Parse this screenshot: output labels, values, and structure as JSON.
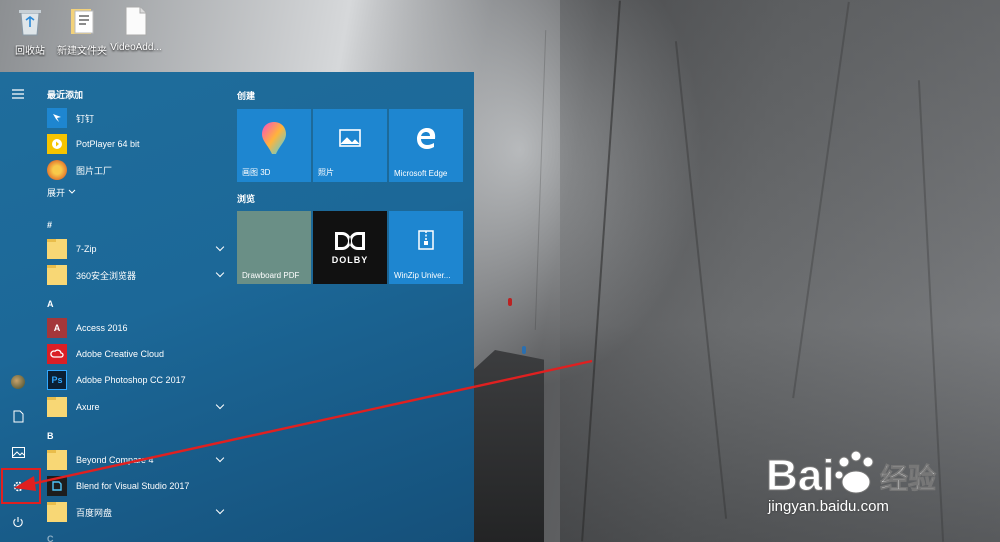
{
  "desktop": {
    "icons": [
      {
        "label": "回收站",
        "icon": "recycle-bin-icon"
      },
      {
        "label": "新建文件夹",
        "icon": "folder-icon"
      },
      {
        "label": "VideoAdd...",
        "icon": "file-icon"
      }
    ]
  },
  "start_menu": {
    "recent_header": "最近添加",
    "recent_apps": [
      {
        "name": "钉钉",
        "icon": "dingtalk-icon"
      },
      {
        "name": "PotPlayer 64 bit",
        "icon": "potplayer-icon"
      },
      {
        "name": "图片工厂",
        "icon": "picture-factory-icon"
      }
    ],
    "expand_label": "展开",
    "letters": {
      "hash": "#",
      "a": "A",
      "b": "B",
      "c": "C"
    },
    "apps_hash": [
      {
        "name": "7-Zip"
      },
      {
        "name": "360安全浏览器"
      }
    ],
    "apps_a": [
      {
        "name": "Access 2016",
        "icon_text": "A"
      },
      {
        "name": "Adobe Creative Cloud"
      },
      {
        "name": "Adobe Photoshop CC 2017",
        "icon_text": "Ps"
      },
      {
        "name": "Axure"
      }
    ],
    "apps_b": [
      {
        "name": "Beyond Compare 4"
      },
      {
        "name": "Blend for Visual Studio 2017"
      },
      {
        "name": "百度网盘"
      }
    ],
    "groups": [
      {
        "title": "创建",
        "tiles": [
          {
            "label": "画图 3D",
            "icon": "paint3d-icon"
          },
          {
            "label": "照片",
            "icon": "photos-icon"
          },
          {
            "label": "Microsoft Edge",
            "icon": "edge-icon"
          }
        ]
      },
      {
        "title": "浏览",
        "tiles": [
          {
            "label": "Drawboard PDF",
            "icon": "drawboard-icon"
          },
          {
            "label": "",
            "icon": "dolby-icon",
            "logo_text": "DOLBY"
          },
          {
            "label": "WinZip Univer...",
            "icon": "winzip-icon"
          }
        ]
      }
    ],
    "colors": {
      "tile_blue": "#1e86d0",
      "tile_sage": "#6a8f86",
      "tile_black": "#111111",
      "highlight_box": "#e02020"
    }
  },
  "watermark": {
    "brand": "Bai 经验",
    "url": "jingyan.baidu.com"
  }
}
